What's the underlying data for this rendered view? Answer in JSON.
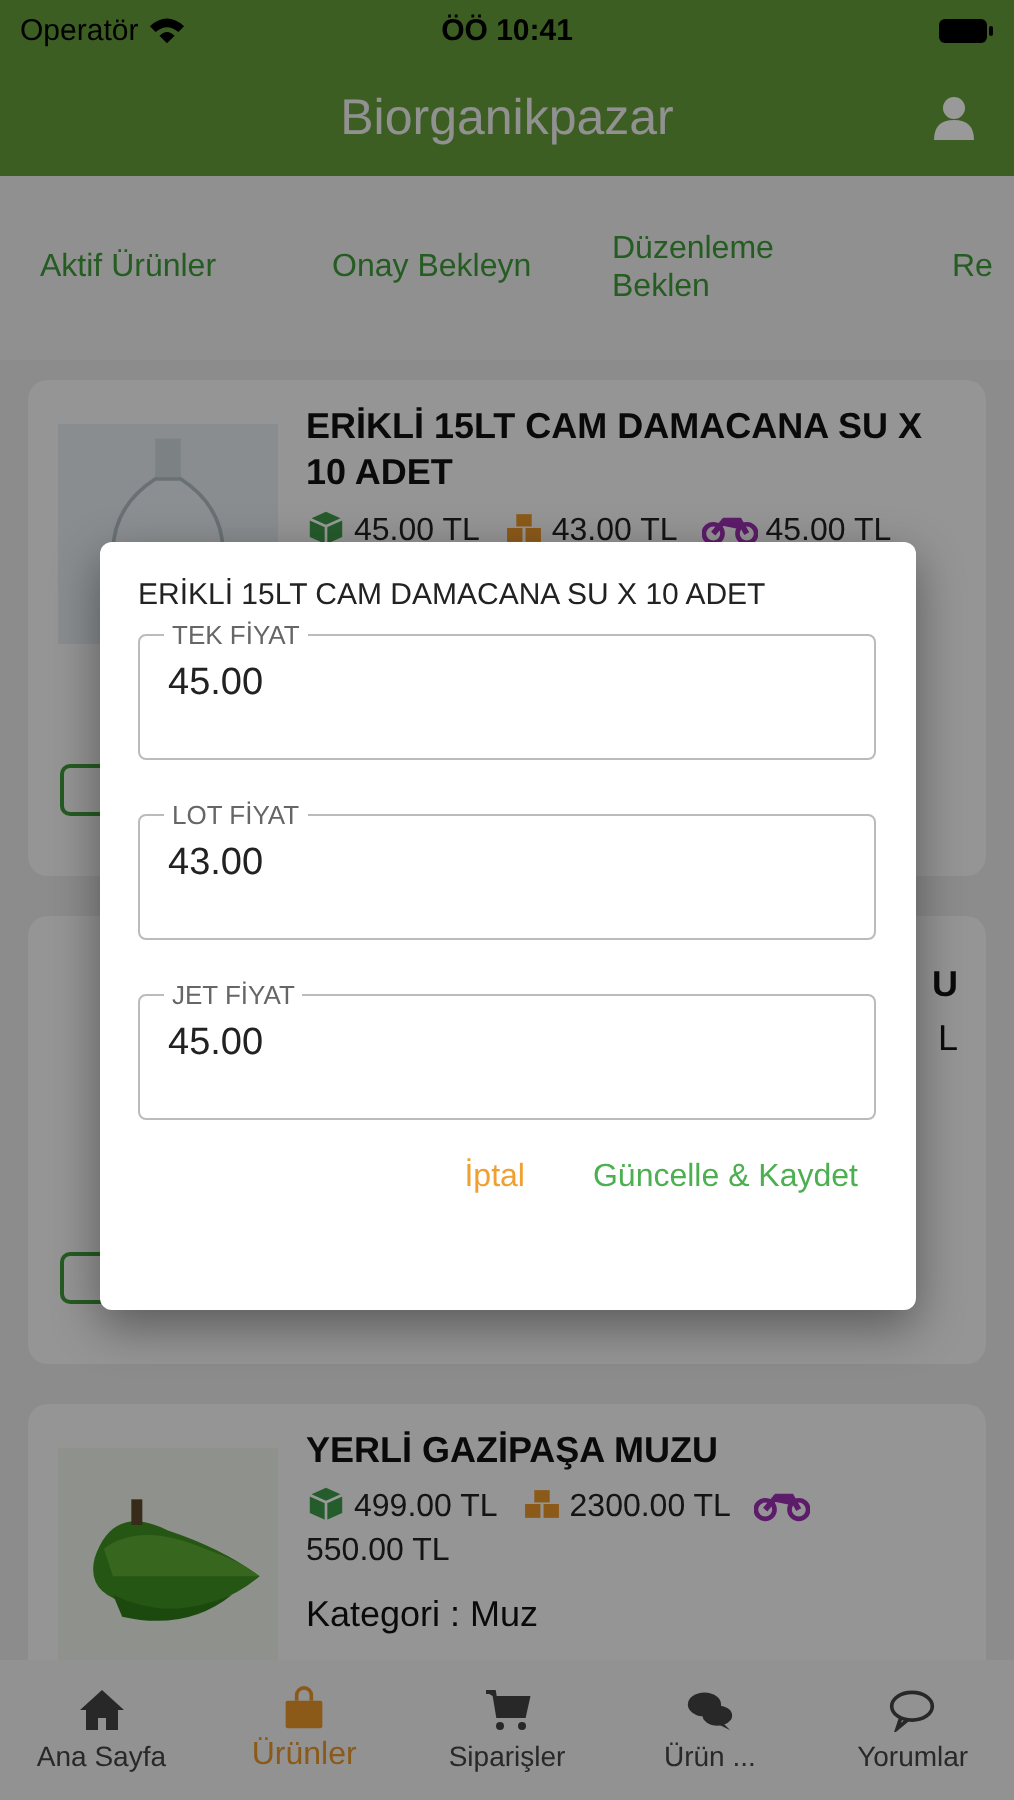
{
  "status_bar": {
    "carrier": "Operatör",
    "time": "ÖÖ 10:41"
  },
  "header": {
    "title": "Biorganikpazar"
  },
  "tabs": [
    {
      "label": "Aktif Ürünler"
    },
    {
      "label": "Onay Bekleyn"
    },
    {
      "label": "Düzenleme Beklen"
    },
    {
      "label": "Re"
    }
  ],
  "products": [
    {
      "image": {
        "kind": "picture"
      },
      "title": "ERİKLİ 15LT CAM DAMACANA SU X 10 ADET",
      "prices": [
        {
          "kind": "unit",
          "text": "45.00 TL"
        },
        {
          "kind": "lot",
          "text": "43.00 TL"
        },
        {
          "kind": "express",
          "text": "45.00 TL"
        }
      ]
    },
    {
      "title_fragment": "U",
      "price_fragment": "L"
    },
    {
      "image": {
        "kind": "picture"
      },
      "title": "YERLİ GAZİPAŞA MUZU",
      "prices": [
        {
          "kind": "unit",
          "text": "499.00 TL"
        },
        {
          "kind": "lot",
          "text": "2300.00 TL"
        },
        {
          "kind": "express",
          "text": "550.00 TL"
        }
      ],
      "category": "Kategori : Muz"
    }
  ],
  "dialog": {
    "title": "ERİKLİ 15LT CAM DAMACANA SU X 10 ADET",
    "fields": [
      {
        "label": "TEK FİYAT",
        "value": "45.00"
      },
      {
        "label": "LOT FİYAT",
        "value": "43.00"
      },
      {
        "label": "JET FİYAT",
        "value": "45.00"
      }
    ],
    "buttons": [
      {
        "kind": "cancel",
        "label": "İptal"
      },
      {
        "kind": "confirm",
        "label": "Güncelle & Kaydet"
      }
    ]
  },
  "bottom_nav": [
    {
      "kind": "home",
      "label": "Ana Sayfa",
      "selected": false
    },
    {
      "kind": "bag",
      "label": "Ürünler",
      "selected": true
    },
    {
      "kind": "cart",
      "label": "Siparişler",
      "selected": false
    },
    {
      "kind": "chats",
      "label": "Ürün ...",
      "selected": false
    },
    {
      "kind": "comment",
      "label": "Yorumlar",
      "selected": false
    }
  ]
}
